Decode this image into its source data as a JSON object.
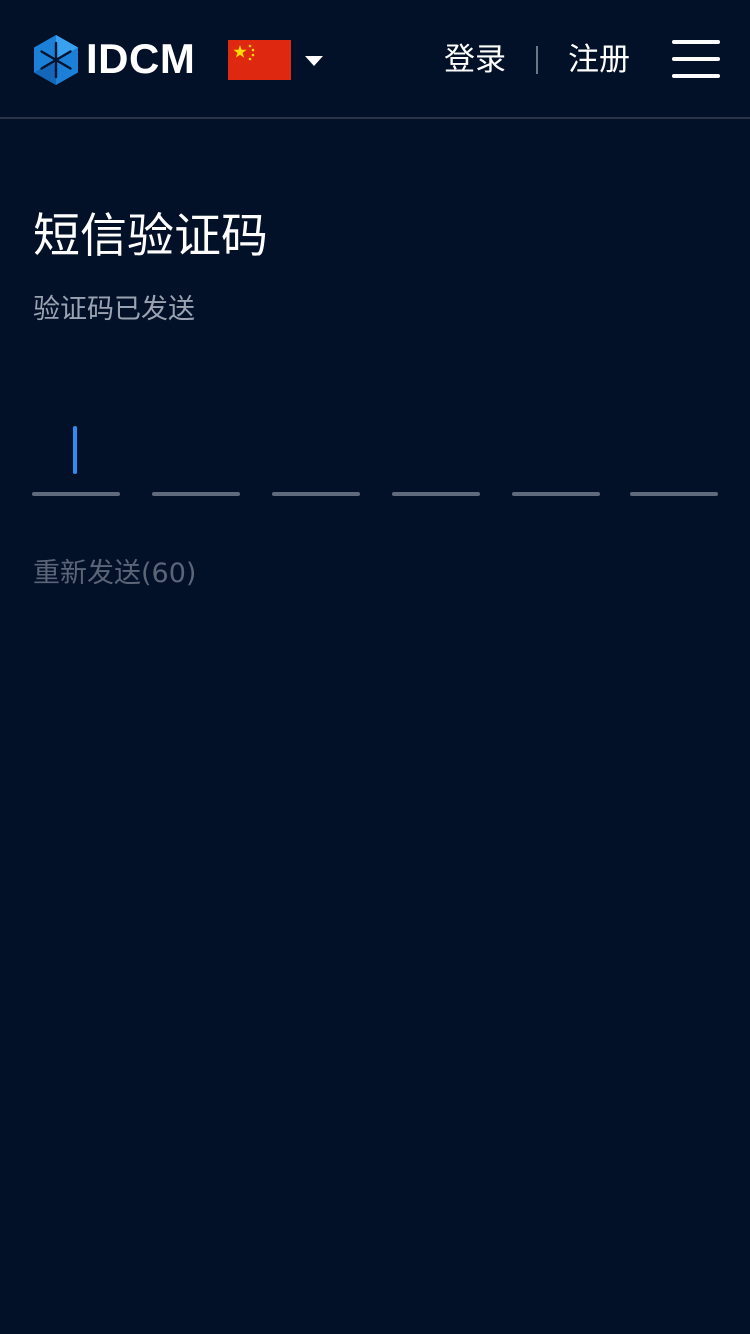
{
  "header": {
    "logo_text": "IDCM",
    "login_label": "登录",
    "register_label": "注册"
  },
  "main": {
    "title": "短信验证码",
    "subtitle": "验证码已发送",
    "code_length": 6,
    "resend_label": "重新发送(60)"
  },
  "colors": {
    "background": "#021028",
    "accent": "#2f8cf0",
    "muted_text": "#9aa3b2",
    "disabled_text": "#5b6577",
    "flag_red": "#de2910",
    "flag_star": "#ffde00"
  },
  "icons": {
    "logo": "hexagon-logo-icon",
    "flag": "china-flag-icon",
    "caret": "caret-down-icon",
    "menu": "hamburger-menu-icon"
  }
}
